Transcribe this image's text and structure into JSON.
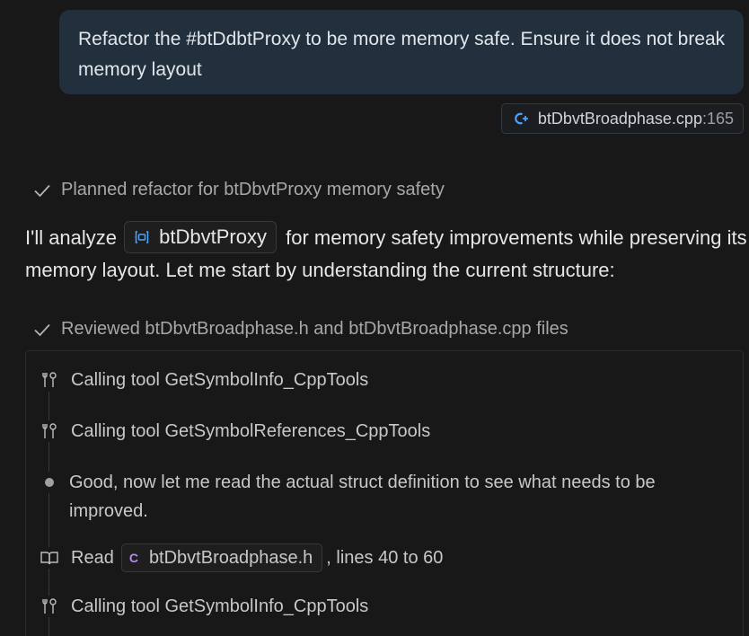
{
  "user_message": {
    "text": "Refactor the #btDdbtProxy to be more memory safe. Ensure it does not break memory layout"
  },
  "attachment": {
    "filename": "btDbvtBroadphase.cpp",
    "line": ":165",
    "icon": "cpp-file-icon"
  },
  "status1": {
    "text": "Planned refactor for btDbvtProxy memory safety"
  },
  "paragraph": {
    "before": "I'll analyze",
    "symbol": "btDbvtProxy",
    "after": "for memory safety improvements while preserving its memory layout. Let me start by understanding the current structure:"
  },
  "status2": {
    "text": "Reviewed btDbvtBroadphase.h and btDbvtBroadphase.cpp files"
  },
  "tools": {
    "call1": "Calling tool GetSymbolInfo_CppTools",
    "call2": "Calling tool GetSymbolReferences_CppTools",
    "thought": "Good, now let me read the actual struct definition to see what needs to be improved.",
    "read_label": "Read",
    "read_file": "btDbvtBroadphase.h",
    "read_c_glyph": "C",
    "read_suffix": ", lines 40 to 60",
    "call3": "Calling tool GetSymbolInfo_CppTools"
  },
  "colors": {
    "background": "#181818",
    "bubble": "#22303d",
    "accent_blue": "#4aa3ff",
    "c_file_purple": "#b48cf2"
  }
}
